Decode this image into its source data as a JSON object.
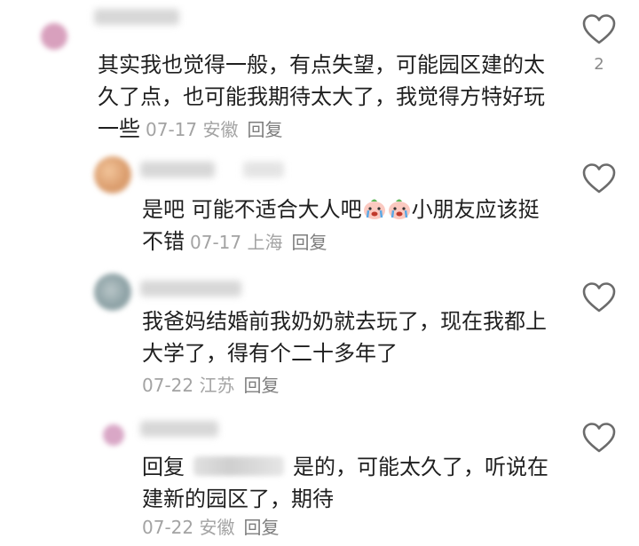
{
  "comments": [
    {
      "text": "其实我也觉得一般，有点失望，可能园区建的太久了点，也可能我期待太大了，我觉得方特好玩一些",
      "date": "07-17",
      "location": "安徽",
      "reply_label": "回复",
      "like_count": "2"
    },
    {
      "text_before": "是吧 可能不适合大人吧",
      "text_after": "小朋友应该挺不错",
      "emoji": "crying-face-emoji",
      "date": "07-17",
      "location": "上海",
      "reply_label": "回复"
    },
    {
      "text": "我爸妈结婚前我奶奶就去玩了，现在我都上大学了，得有个二十多年了",
      "date": "07-22",
      "location": "江苏",
      "reply_label": "回复"
    },
    {
      "reply_prefix": "回复",
      "text": "是的，可能太久了，听说在建新的园区了，期待",
      "date": "07-22",
      "location": "安徽",
      "reply_label": "回复"
    }
  ],
  "icons": {
    "like": "heart-outline-icon"
  },
  "colors": {
    "text": "#1f1f1f",
    "meta": "#a3a3a3",
    "reply": "#7d7d7d",
    "icon": "#6b6b6b"
  }
}
